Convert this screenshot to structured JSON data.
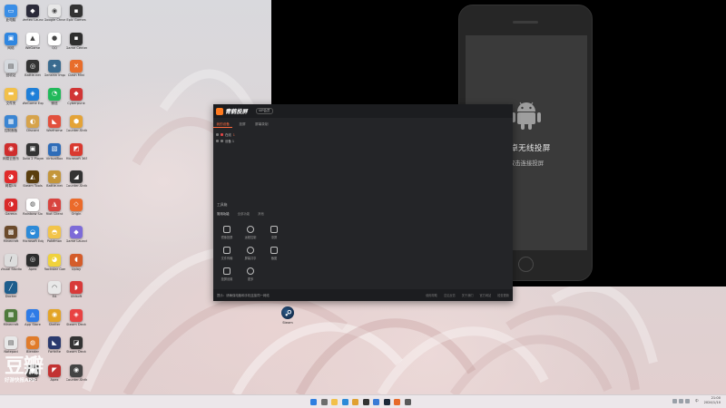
{
  "desktop": {
    "icons": [
      {
        "label": "此电脑",
        "color": "#3a8ee6",
        "glyph": "▭"
      },
      {
        "label": "Vertex Launcher",
        "color": "#2b2b3a",
        "glyph": "◆"
      },
      {
        "label": "Google Chrome",
        "color": "#e8e8e8",
        "glyph": "◉"
      },
      {
        "label": "Epic Games",
        "color": "#333",
        "glyph": "▪"
      },
      {
        "label": "网络",
        "color": "#2f86e0",
        "glyph": "▣"
      },
      {
        "label": "WeGame",
        "color": "#fff",
        "glyph": "▲"
      },
      {
        "label": "QQ",
        "color": "#fff",
        "glyph": "●"
      },
      {
        "label": "Game Center",
        "color": "#2f2f2f",
        "glyph": "▪"
      },
      {
        "label": "回收站",
        "color": "#d5d9de",
        "glyph": "▤"
      },
      {
        "label": "Battle.net",
        "color": "#333",
        "glyph": "◎"
      },
      {
        "label": "Genshin Impact",
        "color": "#3a6b8f",
        "glyph": "✦"
      },
      {
        "label": "Clash Mini",
        "color": "#e86d2b",
        "glyph": "✕"
      },
      {
        "label": "文件夹",
        "color": "#f2c04a",
        "glyph": "▬"
      },
      {
        "label": "WeGame Express",
        "color": "#1f7fd8",
        "glyph": "◈"
      },
      {
        "label": "微信",
        "color": "#21b95a",
        "glyph": "◔"
      },
      {
        "label": "Cyberpunk",
        "color": "#d13535",
        "glyph": "◆"
      },
      {
        "label": "控制面板",
        "color": "#3b85d2",
        "glyph": "▦"
      },
      {
        "label": "Discord",
        "color": "#d6a34b",
        "glyph": "◐"
      },
      {
        "label": "Warframe",
        "color": "#e2503d",
        "glyph": "◣"
      },
      {
        "label": "Counter-Strike",
        "color": "#e4a337",
        "glyph": "⬢"
      },
      {
        "label": "网易云音乐",
        "color": "#cf2d2d",
        "glyph": "◉"
      },
      {
        "label": "Dota 2 Player",
        "color": "#333",
        "glyph": "▣"
      },
      {
        "label": "VirtualBox",
        "color": "#2e6cb8",
        "glyph": "▧"
      },
      {
        "label": "Microsoft 365",
        "color": "#d9392f",
        "glyph": "◩"
      },
      {
        "label": "网易UU",
        "color": "#e02a2a",
        "glyph": "◕"
      },
      {
        "label": "Steam Tools",
        "color": "#5a3e0e",
        "glyph": "◭"
      },
      {
        "label": "Battle.net",
        "color": "#c4963a",
        "glyph": "✚"
      },
      {
        "label": "Counter-Strike",
        "color": "#333",
        "glyph": "◢"
      },
      {
        "label": "Garena",
        "color": "#d92a2a",
        "glyph": "◑"
      },
      {
        "label": "Rainbow Six",
        "color": "#fff",
        "glyph": "◍"
      },
      {
        "label": "Riot Client",
        "color": "#d8433e",
        "glyph": "◮"
      },
      {
        "label": "Origin",
        "color": "#eb6a2a",
        "glyph": "◇"
      },
      {
        "label": "Minecraft",
        "color": "#6b4a2c",
        "glyph": "▩"
      },
      {
        "label": "Microsoft Edge",
        "color": "#2c8ad8",
        "glyph": "◒"
      },
      {
        "label": "Pokémon",
        "color": "#f2c44a",
        "glyph": "◓"
      },
      {
        "label": "Game Launcher",
        "color": "#7d6bd8",
        "glyph": "◆"
      },
      {
        "label": "Visual Studio",
        "color": "#ddd",
        "glyph": "∕"
      },
      {
        "label": "Apex",
        "color": "#2d2d2d",
        "glyph": "◎"
      },
      {
        "label": "Rockstar Games",
        "color": "#f0d23c",
        "glyph": "◕"
      },
      {
        "label": "Uplay",
        "color": "#d45c2a",
        "glyph": "◖"
      },
      {
        "label": "Docker",
        "color": "#1d5d8c",
        "glyph": "╱"
      },
      {
        "label": "",
        "color": "transparent",
        "glyph": ""
      },
      {
        "label": "EA",
        "color": "#e8e8e8",
        "glyph": "◠"
      },
      {
        "label": "Ubisoft",
        "color": "#d83a3a",
        "glyph": "◗"
      },
      {
        "label": "Minecraft",
        "color": "#4f7a3c",
        "glyph": "▦"
      },
      {
        "label": "App Store",
        "color": "#2e7be6",
        "glyph": "◬"
      },
      {
        "label": "Shelter",
        "color": "#e3a427",
        "glyph": "◉"
      },
      {
        "label": "Steam Deck",
        "color": "#e84242",
        "glyph": "◈"
      },
      {
        "label": "Notepad",
        "color": "#e8e8e8",
        "glyph": "▤"
      },
      {
        "label": "Blender",
        "color": "#e07b2a",
        "glyph": "◍"
      },
      {
        "label": "Fortnite",
        "color": "#2b3a6e",
        "glyph": "◣"
      },
      {
        "label": "Steam Deck",
        "color": "#333",
        "glyph": "◪"
      },
      {
        "label": "",
        "color": "transparent",
        "glyph": ""
      },
      {
        "label": "PUBG",
        "color": "#3a3a3a",
        "glyph": "◆"
      },
      {
        "label": "Apex",
        "color": "#c23232",
        "glyph": "◤"
      },
      {
        "label": "Counter-Strike",
        "color": "#444",
        "glyph": "◉"
      }
    ]
  },
  "mirror_window": {
    "title": "安卓无线投屏",
    "subtitle": "双击连接投屏",
    "icon": "android-icon"
  },
  "app_window": {
    "brand": "青鹤投屏",
    "badge": "VIP会员",
    "tabs": [
      "我的设备",
      "投屏",
      "屏幕录制"
    ],
    "list": [
      {
        "name": "在线",
        "value": "1"
      },
      {
        "name": "设备 1",
        "value": ""
      }
    ],
    "tools_heading": "工具箱",
    "tools_subtabs": [
      "常用功能",
      "全部功能",
      "其他"
    ],
    "tools": [
      {
        "label": "镜像投屏",
        "icon": "screen-icon"
      },
      {
        "label": "远程控制",
        "icon": "remote-icon"
      },
      {
        "label": "录屏",
        "icon": "record-icon"
      },
      {
        "label": "文件传输",
        "icon": "file-transfer-icon"
      },
      {
        "label": "屏幕共享",
        "icon": "share-icon"
      },
      {
        "label": "截图",
        "icon": "screenshot-icon"
      },
      {
        "label": "投屏设置",
        "icon": "box-icon"
      },
      {
        "label": "更多",
        "icon": "more-icon"
      }
    ],
    "footer_note": "提示：请确保电脑和手机连接同一网络",
    "footer_links": [
      "使用帮助",
      "意见反馈",
      "关于我们",
      "官方网站",
      "检查更新"
    ]
  },
  "steam_shortcut": {
    "label": "Steam"
  },
  "watermark": {
    "big": "豆瓣",
    "small": "好游快报APP"
  },
  "taskbar": {
    "apps": [
      {
        "name": "start",
        "color": "#2f7fe0"
      },
      {
        "name": "search",
        "color": "#6d6d6d"
      },
      {
        "name": "file-explorer",
        "color": "#f2c04a"
      },
      {
        "name": "edge",
        "color": "#2c8ad8"
      },
      {
        "name": "chrome",
        "color": "#e0a030"
      },
      {
        "name": "terminal",
        "color": "#333"
      },
      {
        "name": "mail",
        "color": "#3a7bd5"
      },
      {
        "name": "steam",
        "color": "#1b2838"
      },
      {
        "name": "app-panel",
        "color": "#e66a2a"
      },
      {
        "name": "settings",
        "color": "#5a5a5a"
      }
    ],
    "lang": "中",
    "time": "21:00",
    "date": "2024/1/10"
  }
}
